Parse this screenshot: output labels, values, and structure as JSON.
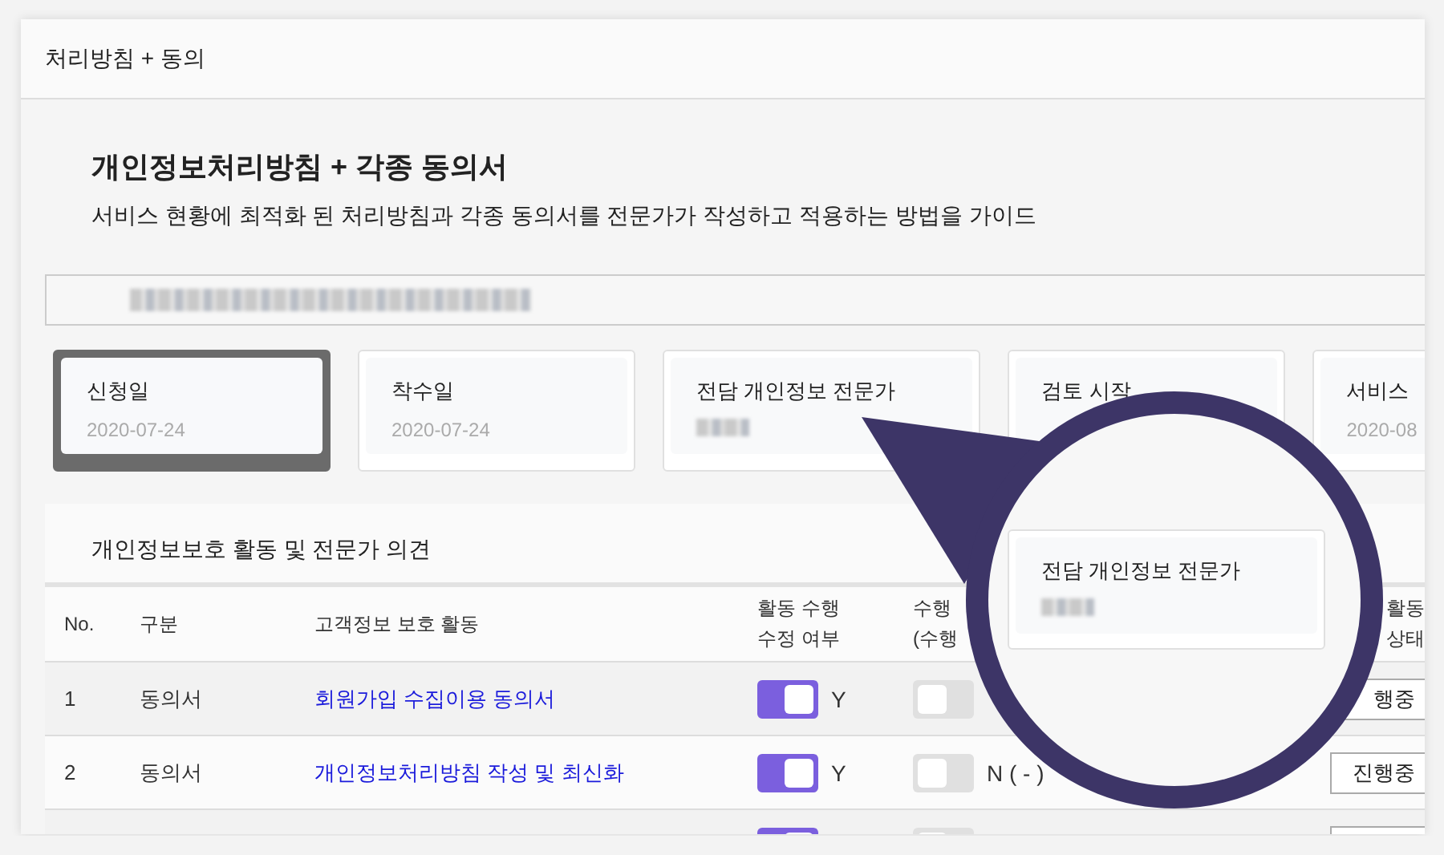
{
  "window": {
    "title": "처리방침 + 동의"
  },
  "heading": {
    "title": "개인정보처리방침 + 각종 동의서",
    "description": "서비스 현황에 최적화 된 처리방침과 각종 동의서를 전문가가 작성하고 적용하는 방법을 가이드"
  },
  "search": {
    "redacted": true
  },
  "milestones": [
    {
      "label": "신청일",
      "value": "2020-07-24",
      "redacted": false,
      "selected": true
    },
    {
      "label": "착수일",
      "value": "2020-07-24",
      "redacted": false,
      "selected": false
    },
    {
      "label": "전담 개인정보 전문가",
      "redacted": true,
      "selected": false
    },
    {
      "label": "검토 시작",
      "redacted": false,
      "selected": false
    },
    {
      "label": "서비스",
      "value": "2020-08",
      "redacted": false,
      "selected": false
    }
  ],
  "magnifier": {
    "label": "전담 개인정보 전문가",
    "redacted": true
  },
  "table": {
    "title": "개인정보보호 활동 및 전문가 의견",
    "columns": [
      {
        "lines": [
          "No."
        ]
      },
      {
        "lines": [
          "구분"
        ]
      },
      {
        "lines": [
          "고객정보 보호 활동"
        ]
      },
      {
        "lines": [
          "활동 수행",
          "수정 여부"
        ]
      },
      {
        "lines": [
          "수행",
          "(수행"
        ]
      },
      {
        "lines": [
          "활동",
          "상태"
        ]
      }
    ],
    "rows": [
      {
        "no": "1",
        "category": "동의서",
        "activity": "회원가입 수집이용 동의서",
        "edit_switch": {
          "on": true,
          "label": "Y"
        },
        "done_switch": {
          "on": false
        },
        "status": "행중"
      },
      {
        "no": "2",
        "category": "동의서",
        "activity": "개인정보처리방침 작성 및 최신화",
        "edit_switch": {
          "on": true,
          "label": "Y"
        },
        "done_switch": {
          "on": false,
          "label": "N ( - )"
        },
        "status": "진행중"
      },
      {
        "edit_switch": {
          "on": true
        },
        "done_switch": {
          "on": false
        }
      }
    ]
  }
}
